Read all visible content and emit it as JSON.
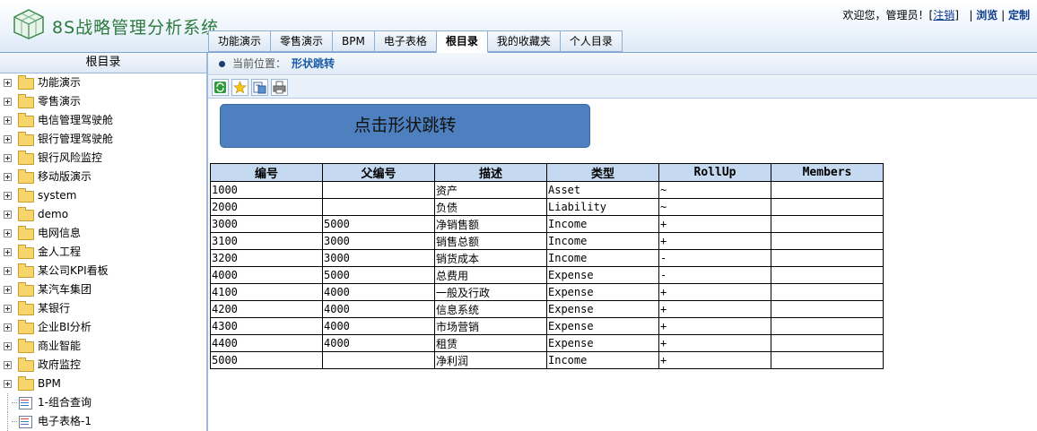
{
  "app": {
    "title": "8S战略管理分析系统"
  },
  "user_links": {
    "welcome": "欢迎您，管理员！[",
    "logout": "注销",
    "close_bracket": "]",
    "sep1": "|",
    "browse": "浏览",
    "sep2": "|",
    "customize": "定制"
  },
  "tabs": [
    {
      "label": "功能演示",
      "active": false
    },
    {
      "label": "零售演示",
      "active": false
    },
    {
      "label": "BPM",
      "active": false
    },
    {
      "label": "电子表格",
      "active": false
    },
    {
      "label": "根目录",
      "active": true
    },
    {
      "label": "我的收藏夹",
      "active": false
    },
    {
      "label": "个人目录",
      "active": false
    }
  ],
  "sidebar": {
    "title": "根目录",
    "items": [
      {
        "label": "功能演示",
        "icon": "folder-icon"
      },
      {
        "label": "零售演示",
        "icon": "folder-icon"
      },
      {
        "label": "电信管理驾驶舱",
        "icon": "folder-icon"
      },
      {
        "label": "银行管理驾驶舱",
        "icon": "folder-icon"
      },
      {
        "label": "银行风险监控",
        "icon": "folder-icon"
      },
      {
        "label": "移动版演示",
        "icon": "folder-icon"
      },
      {
        "label": "system",
        "icon": "folder-icon"
      },
      {
        "label": "demo",
        "icon": "folder-icon"
      },
      {
        "label": "电网信息",
        "icon": "folder-icon"
      },
      {
        "label": "金人工程",
        "icon": "folder-icon"
      },
      {
        "label": "某公司KPI看板",
        "icon": "folder-icon"
      },
      {
        "label": "某汽车集团",
        "icon": "folder-icon"
      },
      {
        "label": "某银行",
        "icon": "folder-icon"
      },
      {
        "label": "企业BI分析",
        "icon": "folder-icon"
      },
      {
        "label": "商业智能",
        "icon": "folder-icon"
      },
      {
        "label": "政府监控",
        "icon": "folder-icon"
      },
      {
        "label": "BPM",
        "icon": "folder-icon"
      },
      {
        "label": "1-组合查询",
        "icon": "report-icon"
      },
      {
        "label": "电子表格-1",
        "icon": "report-icon"
      }
    ]
  },
  "breadcrumb": {
    "prefix": "当前位置：",
    "current": "形状跳转"
  },
  "toolbar": {
    "buttons": [
      "refresh-icon",
      "favorite-star-icon",
      "export-icon",
      "print-icon"
    ]
  },
  "shape": {
    "label": "点击形状跳转",
    "fill": "#4e80bf"
  },
  "table": {
    "headers": [
      "编号",
      "父编号",
      "描述",
      "类型",
      "RollUp",
      "Members"
    ],
    "rows": [
      [
        "1000",
        "",
        "资产",
        "Asset",
        "~",
        ""
      ],
      [
        "2000",
        "",
        "负债",
        "Liability",
        "~",
        ""
      ],
      [
        "3000",
        "5000",
        "净销售额",
        "Income",
        "+",
        ""
      ],
      [
        "3100",
        "3000",
        "销售总额",
        "Income",
        "+",
        ""
      ],
      [
        "3200",
        "3000",
        "销货成本",
        "Income",
        "-",
        ""
      ],
      [
        "4000",
        "5000",
        "总费用",
        "Expense",
        "-",
        ""
      ],
      [
        "4100",
        "4000",
        "一般及行政",
        "Expense",
        "+",
        ""
      ],
      [
        "4200",
        "4000",
        "信息系统",
        "Expense",
        "+",
        ""
      ],
      [
        "4300",
        "4000",
        "市场营销",
        "Expense",
        "+",
        ""
      ],
      [
        "4400",
        "4000",
        "租赁",
        "Expense",
        "+",
        ""
      ],
      [
        "5000",
        "",
        "净利润",
        "Income",
        "+",
        ""
      ]
    ]
  }
}
